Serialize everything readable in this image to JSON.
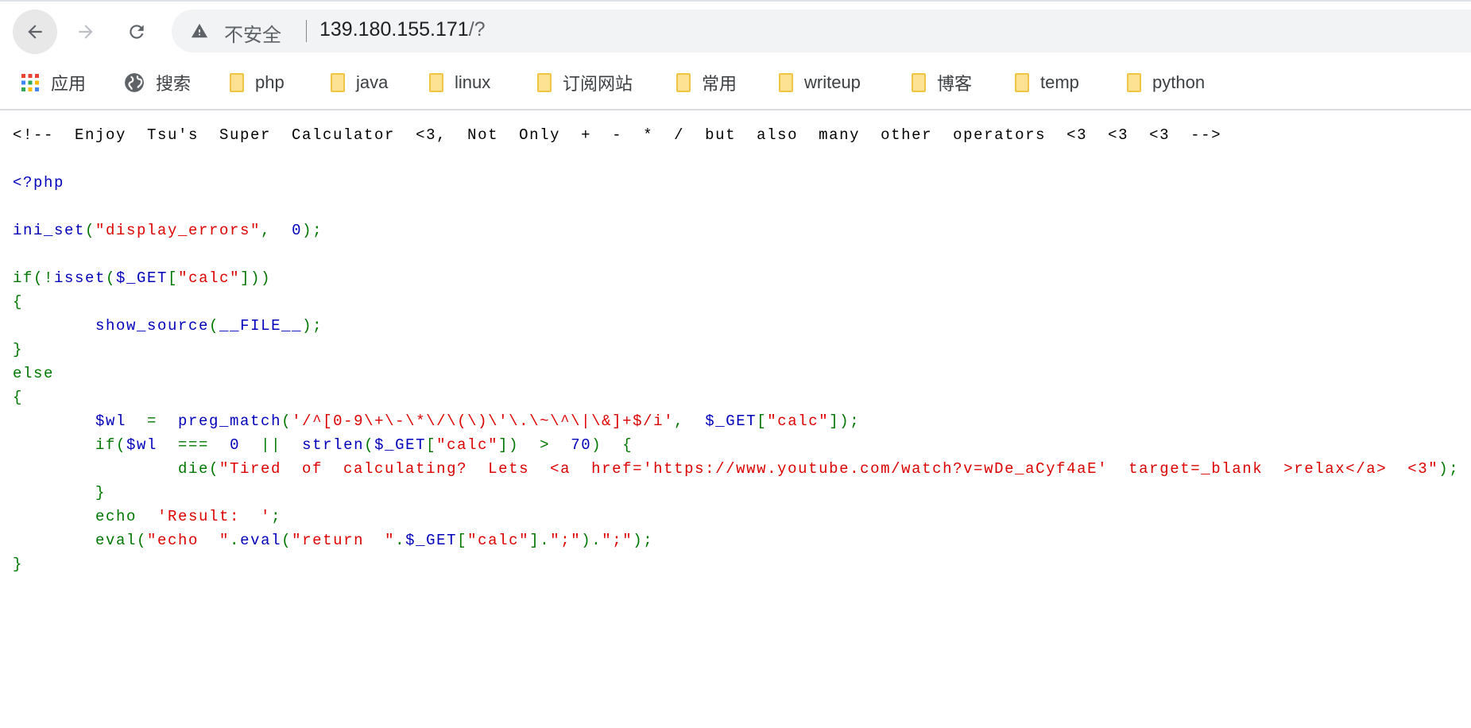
{
  "browser": {
    "security_label": "不安全",
    "url_host": "139.180.155.171",
    "url_path": "/?",
    "icons": [
      "back-arrow-icon",
      "forward-arrow-icon",
      "reload-icon",
      "warning-icon"
    ]
  },
  "bookmarks": [
    {
      "label": "应用",
      "icon": "apps-grid-icon"
    },
    {
      "label": "搜索",
      "icon": "globe-icon"
    },
    {
      "label": "php",
      "icon": "folder-icon"
    },
    {
      "label": "java",
      "icon": "folder-icon"
    },
    {
      "label": "linux",
      "icon": "folder-icon"
    },
    {
      "label": "订阅网站",
      "icon": "folder-icon"
    },
    {
      "label": "常用",
      "icon": "folder-icon"
    },
    {
      "label": "writeup",
      "icon": "folder-icon"
    },
    {
      "label": "博客",
      "icon": "folder-icon"
    },
    {
      "label": "temp",
      "icon": "folder-icon"
    },
    {
      "label": "python",
      "icon": "folder-icon"
    }
  ],
  "colors": {
    "html": "#000000",
    "default": "#0000BB",
    "keyword": "#007700",
    "string": "#DD0000"
  },
  "code_lines": [
    [
      [
        "html",
        "<!-- Enjoy Tsu's Super Calculator <3, Not Only + - * / but also many other operators <3 <3 <3 -->"
      ]
    ],
    [],
    [
      [
        "default",
        "<?php"
      ]
    ],
    [],
    [
      [
        "default",
        "ini_set"
      ],
      [
        "keyword",
        "("
      ],
      [
        "string",
        "\"display_errors\""
      ],
      [
        "keyword",
        ", "
      ],
      [
        "default",
        "0"
      ],
      [
        "keyword",
        ");"
      ]
    ],
    [],
    [
      [
        "keyword",
        "if(!"
      ],
      [
        "default",
        "isset"
      ],
      [
        "keyword",
        "("
      ],
      [
        "default",
        "$_GET"
      ],
      [
        "keyword",
        "["
      ],
      [
        "string",
        "\"calc\""
      ],
      [
        "keyword",
        "]))"
      ]
    ],
    [
      [
        "keyword",
        "{"
      ]
    ],
    [
      [
        "keyword",
        "\t"
      ],
      [
        "default",
        "show_source"
      ],
      [
        "keyword",
        "("
      ],
      [
        "default",
        "__FILE__"
      ],
      [
        "keyword",
        ");"
      ]
    ],
    [
      [
        "keyword",
        "}"
      ]
    ],
    [
      [
        "keyword",
        "else"
      ]
    ],
    [
      [
        "keyword",
        "{"
      ]
    ],
    [
      [
        "keyword",
        "\t"
      ],
      [
        "default",
        "$wl "
      ],
      [
        "keyword",
        "= "
      ],
      [
        "default",
        "preg_match"
      ],
      [
        "keyword",
        "("
      ],
      [
        "string",
        "'/^[0-9\\+\\-\\*\\/\\(\\)\\'\\.\\~\\^\\|\\&]+$/i'"
      ],
      [
        "keyword",
        ", "
      ],
      [
        "default",
        "$_GET"
      ],
      [
        "keyword",
        "["
      ],
      [
        "string",
        "\"calc\""
      ],
      [
        "keyword",
        "]);"
      ]
    ],
    [
      [
        "keyword",
        "\tif("
      ],
      [
        "default",
        "$wl "
      ],
      [
        "keyword",
        "=== "
      ],
      [
        "default",
        "0 "
      ],
      [
        "keyword",
        "|| "
      ],
      [
        "default",
        "strlen"
      ],
      [
        "keyword",
        "("
      ],
      [
        "default",
        "$_GET"
      ],
      [
        "keyword",
        "["
      ],
      [
        "string",
        "\"calc\""
      ],
      [
        "keyword",
        "]) > "
      ],
      [
        "default",
        "70"
      ],
      [
        "keyword",
        ") {"
      ]
    ],
    [
      [
        "keyword",
        "\t\tdie("
      ],
      [
        "string",
        "\"Tired of calculating? Lets <a href='https://www.youtube.com/watch?v=wDe_aCyf4aE' target=_blank >relax</a> <3\""
      ],
      [
        "keyword",
        ");"
      ]
    ],
    [
      [
        "keyword",
        "\t}"
      ]
    ],
    [
      [
        "keyword",
        "\techo "
      ],
      [
        "string",
        "'Result: '"
      ],
      [
        "keyword",
        ";"
      ]
    ],
    [
      [
        "keyword",
        "\teval("
      ],
      [
        "string",
        "\"echo \""
      ],
      [
        "keyword",
        "."
      ],
      [
        "default",
        "eval"
      ],
      [
        "keyword",
        "("
      ],
      [
        "string",
        "\"return \""
      ],
      [
        "keyword",
        "."
      ],
      [
        "default",
        "$_GET"
      ],
      [
        "keyword",
        "["
      ],
      [
        "string",
        "\"calc\""
      ],
      [
        "keyword",
        "]."
      ],
      [
        "string",
        "\";\""
      ],
      [
        "keyword",
        ")."
      ],
      [
        "string",
        "\";\""
      ],
      [
        "keyword",
        ");"
      ]
    ],
    [
      [
        "keyword",
        "}"
      ]
    ]
  ]
}
